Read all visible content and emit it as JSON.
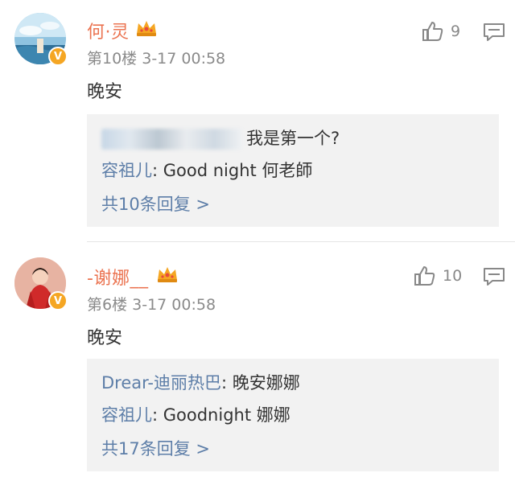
{
  "comments": [
    {
      "username": "何·灵",
      "floor": "第10楼",
      "time": "3-17 00:58",
      "likes": "9",
      "text": "晚安",
      "replies": [
        {
          "name": "",
          "text": "我是第一个?",
          "name_blurred": true
        },
        {
          "name": "容祖儿",
          "text": ": Good night 何老師"
        }
      ],
      "more": "共10条回复 >"
    },
    {
      "username": "-谢娜__",
      "floor": "第6楼",
      "time": "3-17 00:58",
      "likes": "10",
      "text": "晚安",
      "replies": [
        {
          "name": "Drear-迪丽热巴",
          "text": ": 晚安娜娜"
        },
        {
          "name": "容祖儿",
          "text": ": Goodnight 娜娜"
        }
      ],
      "more": "共17条回复 >"
    }
  ],
  "icons": {
    "verified": "v-badge-icon",
    "crown": "crown-icon",
    "like": "thumbs-up-icon",
    "reply": "comment-icon"
  },
  "colors": {
    "username": "#eb7350",
    "link": "#5d7ea8",
    "badge": "#f5a623",
    "reply_bg": "#f2f2f2"
  }
}
